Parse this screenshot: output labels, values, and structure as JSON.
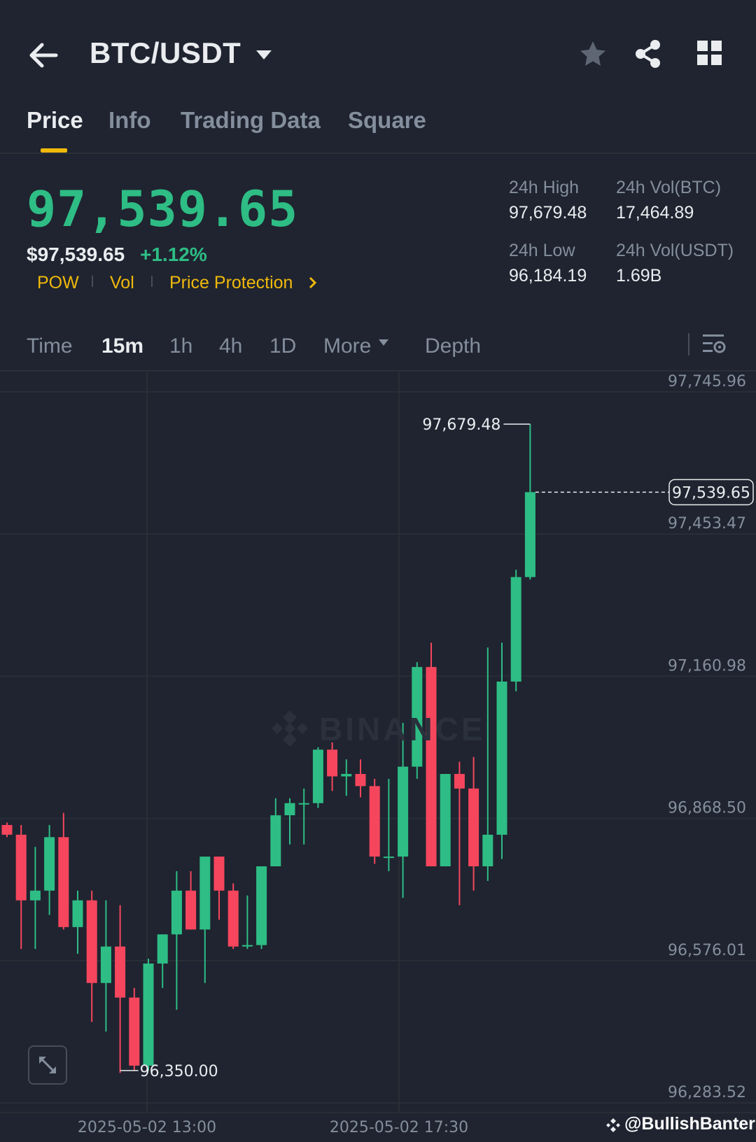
{
  "header": {
    "pair": "BTC/USDT",
    "back_icon": "arrow-left-icon",
    "actions": [
      "star-icon",
      "share-icon",
      "grid-icon"
    ]
  },
  "tabs": [
    {
      "label": "Price",
      "active": true
    },
    {
      "label": "Info",
      "active": false
    },
    {
      "label": "Trading Data",
      "active": false
    },
    {
      "label": "Square",
      "active": false
    }
  ],
  "price": {
    "last": "97,539.65",
    "usd": "$97,539.65",
    "change": "+1.12%",
    "tags": [
      "POW",
      "Vol",
      "Price Protection"
    ]
  },
  "stats": {
    "high_label": "24h High",
    "high_value": "97,679.48",
    "low_label": "24h Low",
    "low_value": "96,184.19",
    "vol_btc_label": "24h Vol(BTC)",
    "vol_btc_value": "17,464.89",
    "vol_usdt_label": "24h Vol(USDT)",
    "vol_usdt_value": "1.69B"
  },
  "intervals": {
    "items": [
      "Time",
      "15m",
      "1h",
      "4h",
      "1D"
    ],
    "active": "15m",
    "more_label": "More",
    "depth_label": "Depth"
  },
  "colors": {
    "up": "#2ebd85",
    "down": "#f6465d",
    "accent": "#f0b90b",
    "background": "#1f2430"
  },
  "chart_data": {
    "type": "candlestick",
    "y_ticks": [
      "97,745.96",
      "97,453.47",
      "97,160.98",
      "96,868.50",
      "96,576.01",
      "96,283.52"
    ],
    "ylim": [
      96283.52,
      97745.96
    ],
    "x_ticks": [
      "2025-05-02 13:00",
      "2025-05-02 17:30"
    ],
    "last_price_label": "97,539.65",
    "high_marker": "97,679.48",
    "low_marker": "96,350.00",
    "watermark": "BINANCE",
    "candles": [
      {
        "o": 96855,
        "h": 96860,
        "l": 96830,
        "c": 96835
      },
      {
        "o": 96835,
        "h": 96855,
        "l": 96600,
        "c": 96700
      },
      {
        "o": 96700,
        "h": 96810,
        "l": 96600,
        "c": 96720
      },
      {
        "o": 96720,
        "h": 96855,
        "l": 96670,
        "c": 96830
      },
      {
        "o": 96830,
        "h": 96880,
        "l": 96640,
        "c": 96645
      },
      {
        "o": 96645,
        "h": 96720,
        "l": 96590,
        "c": 96700
      },
      {
        "o": 96700,
        "h": 96720,
        "l": 96450,
        "c": 96530
      },
      {
        "o": 96530,
        "h": 96700,
        "l": 96430,
        "c": 96605
      },
      {
        "o": 96605,
        "h": 96690,
        "l": 96345,
        "c": 96500
      },
      {
        "o": 96500,
        "h": 96520,
        "l": 96350,
        "c": 96360
      },
      {
        "o": 96360,
        "h": 96580,
        "l": 96350,
        "c": 96570
      },
      {
        "o": 96570,
        "h": 96630,
        "l": 96520,
        "c": 96630
      },
      {
        "o": 96630,
        "h": 96760,
        "l": 96475,
        "c": 96720
      },
      {
        "o": 96720,
        "h": 96760,
        "l": 96640,
        "c": 96640
      },
      {
        "o": 96640,
        "h": 96780,
        "l": 96530,
        "c": 96790
      },
      {
        "o": 96790,
        "h": 96790,
        "l": 96660,
        "c": 96720
      },
      {
        "o": 96720,
        "h": 96735,
        "l": 96600,
        "c": 96605
      },
      {
        "o": 96605,
        "h": 96710,
        "l": 96600,
        "c": 96608
      },
      {
        "o": 96608,
        "h": 96770,
        "l": 96600,
        "c": 96770
      },
      {
        "o": 96770,
        "h": 96910,
        "l": 96770,
        "c": 96875
      },
      {
        "o": 96875,
        "h": 96910,
        "l": 96815,
        "c": 96900
      },
      {
        "o": 96900,
        "h": 96930,
        "l": 96815,
        "c": 96900
      },
      {
        "o": 96900,
        "h": 97015,
        "l": 96890,
        "c": 97010
      },
      {
        "o": 97010,
        "h": 97025,
        "l": 96925,
        "c": 96955
      },
      {
        "o": 96955,
        "h": 96990,
        "l": 96915,
        "c": 96960
      },
      {
        "o": 96960,
        "h": 96990,
        "l": 96912,
        "c": 96935
      },
      {
        "o": 96935,
        "h": 96950,
        "l": 96775,
        "c": 96790
      },
      {
        "o": 96790,
        "h": 96950,
        "l": 96760,
        "c": 96790
      },
      {
        "o": 96790,
        "h": 97065,
        "l": 96705,
        "c": 96975
      },
      {
        "o": 96975,
        "h": 97190,
        "l": 96950,
        "c": 97180
      },
      {
        "o": 97180,
        "h": 97230,
        "l": 96770,
        "c": 96770
      },
      {
        "o": 96770,
        "h": 96960,
        "l": 96770,
        "c": 96960
      },
      {
        "o": 96960,
        "h": 96985,
        "l": 96690,
        "c": 96930
      },
      {
        "o": 96930,
        "h": 96995,
        "l": 96720,
        "c": 96770
      },
      {
        "o": 96770,
        "h": 97220,
        "l": 96740,
        "c": 96835
      },
      {
        "o": 96835,
        "h": 97230,
        "l": 96785,
        "c": 97150
      },
      {
        "o": 97150,
        "h": 97380,
        "l": 97130,
        "c": 97365
      },
      {
        "o": 97365,
        "h": 97679.48,
        "l": 97360,
        "c": 97539.65
      }
    ]
  },
  "credit": "@BullishBanter"
}
